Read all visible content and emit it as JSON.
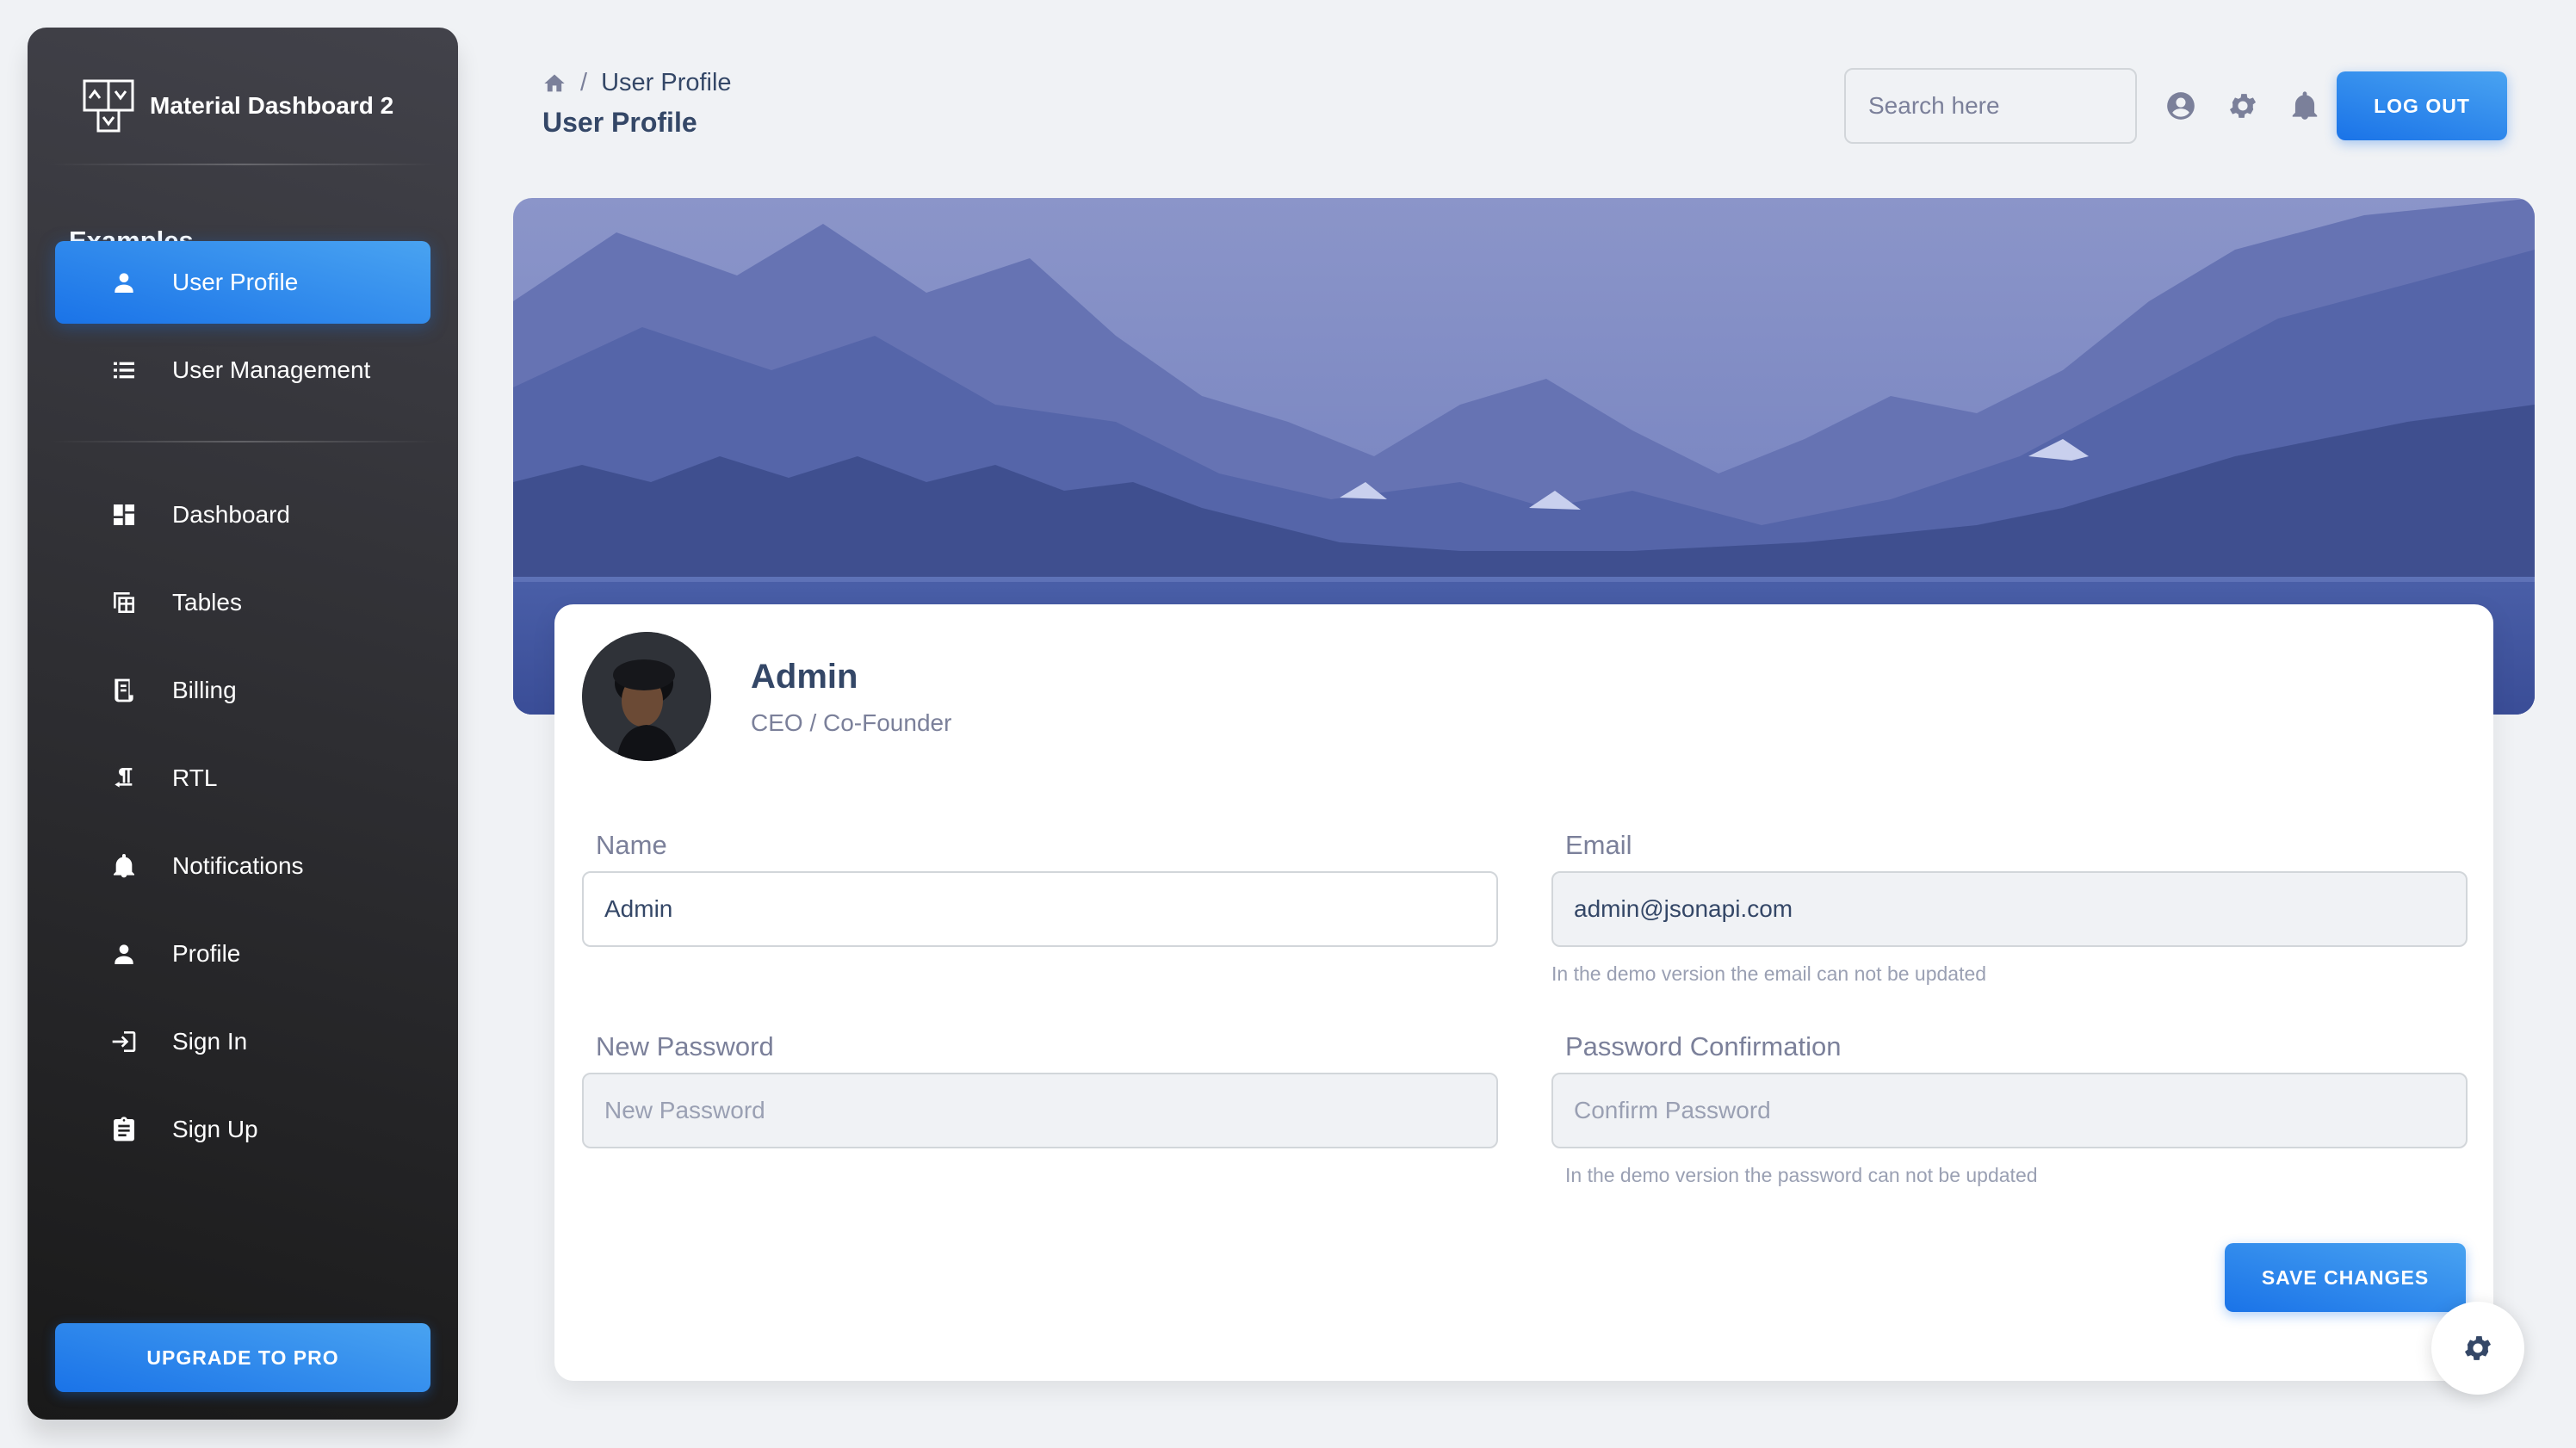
{
  "brand": {
    "name": "Material Dashboard 2"
  },
  "sidebar": {
    "section_title": "Examples",
    "examples": [
      {
        "label": "User Profile",
        "icon": "person-icon",
        "active": true
      },
      {
        "label": "User Management",
        "icon": "list-icon",
        "active": false
      }
    ],
    "items": [
      {
        "label": "Dashboard",
        "icon": "dashboard-icon"
      },
      {
        "label": "Tables",
        "icon": "table-icon"
      },
      {
        "label": "Billing",
        "icon": "receipt-icon"
      },
      {
        "label": "RTL",
        "icon": "rtl-icon"
      },
      {
        "label": "Notifications",
        "icon": "bell-icon"
      },
      {
        "label": "Profile",
        "icon": "person-icon"
      },
      {
        "label": "Sign In",
        "icon": "login-icon"
      },
      {
        "label": "Sign Up",
        "icon": "assignment-icon"
      }
    ],
    "upgrade_label": "UPGRADE TO PRO"
  },
  "navbar": {
    "breadcrumb_current": "User Profile",
    "breadcrumb_sep": "/",
    "page_title": "User Profile",
    "search_placeholder": "Search here",
    "logout_label": "LOG OUT"
  },
  "profile": {
    "name": "Admin",
    "role": "CEO / Co-Founder"
  },
  "form": {
    "name_label": "Name",
    "name_value": "Admin",
    "email_label": "Email",
    "email_value": "admin@jsonapi.com",
    "email_helper": "In the demo version the email can not be updated",
    "new_password_label": "New Password",
    "new_password_placeholder": "New Password",
    "confirm_label": "Password Confirmation",
    "confirm_placeholder": "Confirm Password",
    "password_helper": "In the demo version the password can not be updated",
    "save_label": "SAVE CHANGES"
  },
  "colors": {
    "accent": "#1A73E8",
    "sidebar_dark": "#191919",
    "text": "#344767",
    "muted": "#7b809a"
  }
}
